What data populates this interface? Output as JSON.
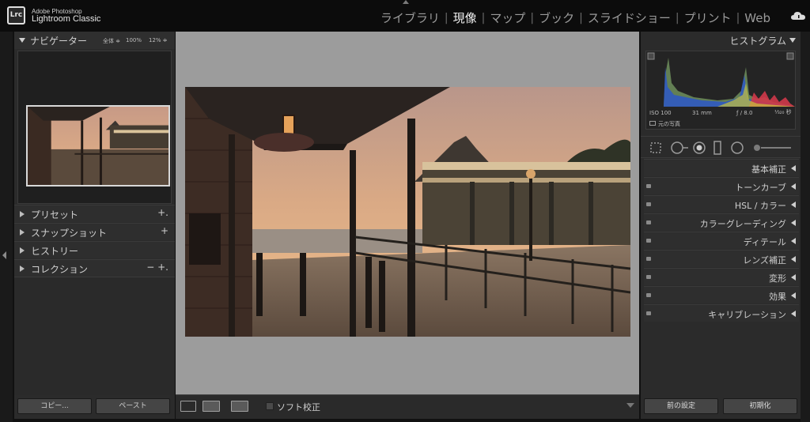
{
  "app": {
    "logo": "Lrc",
    "vendor": "Adobe Photoshop",
    "name": "Lightroom Classic"
  },
  "modules": [
    {
      "label": "ライブラリ",
      "active": false
    },
    {
      "label": "現像",
      "active": true
    },
    {
      "label": "マップ",
      "active": false
    },
    {
      "label": "ブック",
      "active": false
    },
    {
      "label": "スライドショー",
      "active": false
    },
    {
      "label": "プリント",
      "active": false
    },
    {
      "label": "Web",
      "active": false
    }
  ],
  "left_panel": {
    "navigator": {
      "title": "ナビゲーター",
      "zoom_fit": "全体 ≑",
      "zoom_100": "100%",
      "zoom_custom": "12% ≑"
    },
    "sections": [
      {
        "label": "プリセット",
        "action": "+."
      },
      {
        "label": "スナップショット",
        "action": "+"
      },
      {
        "label": "ヒストリー",
        "action": ""
      },
      {
        "label": "コレクション",
        "action": "−  +."
      }
    ],
    "copy_button": "コピー...",
    "paste_button": "ペースト"
  },
  "toolbar": {
    "soft_proof_label": "ソフト校正"
  },
  "right_panel": {
    "histogram": {
      "title": "ヒストグラム",
      "iso": "ISO 100",
      "focal": "31 mm",
      "aperture": "ƒ / 8.0",
      "shutter": "¹⁄₃₂₀ 秒",
      "original_photo": "元の写真"
    },
    "panels": [
      {
        "label": "基本補正"
      },
      {
        "label": "トーンカーブ"
      },
      {
        "label": "HSL / カラー"
      },
      {
        "label": "カラーグレーディング"
      },
      {
        "label": "ディテール"
      },
      {
        "label": "レンズ補正"
      },
      {
        "label": "変形"
      },
      {
        "label": "効果"
      },
      {
        "label": "キャリブレーション"
      }
    ],
    "previous_button": "前の設定",
    "reset_button": "初期化"
  },
  "colors": {
    "background": "#111111",
    "panel": "#2b2b2b",
    "canvas": "#9c9c9c",
    "active_module": "#f0f0f0",
    "inactive_module": "#9b9b9b"
  }
}
